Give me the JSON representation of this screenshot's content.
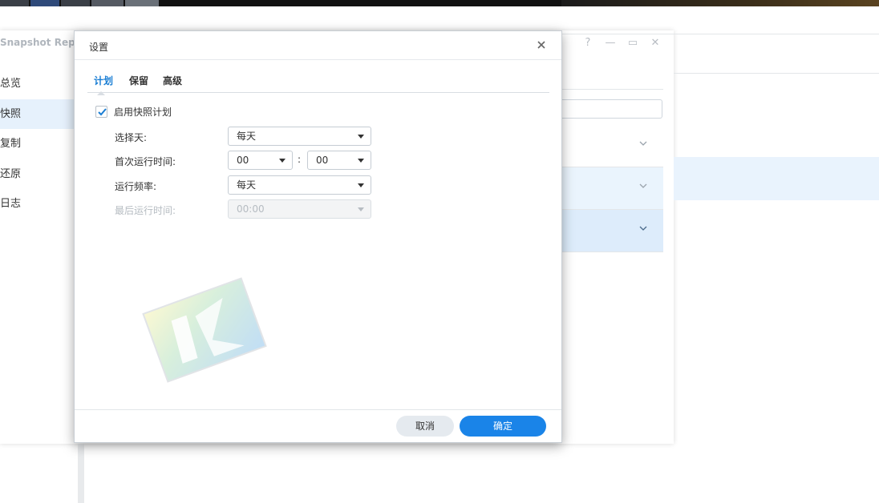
{
  "background_app": {
    "title": "Snapshot Repl",
    "window_controls": [
      "?",
      "—",
      "▭",
      "✕"
    ],
    "sidebar": {
      "items": [
        {
          "label": "总览",
          "active": false
        },
        {
          "label": "快照",
          "active": true
        },
        {
          "label": "复制",
          "active": false
        },
        {
          "label": "还原",
          "active": false
        },
        {
          "label": "日志",
          "active": false
        }
      ]
    }
  },
  "dialog": {
    "title": "设置",
    "tabs": [
      {
        "label": "计划",
        "active": true
      },
      {
        "label": "保留",
        "active": false
      },
      {
        "label": "高级",
        "active": false
      }
    ],
    "enable_schedule": {
      "label": "启用快照计划",
      "checked": true
    },
    "fields": {
      "select_day": {
        "label": "选择天:",
        "value": "每天"
      },
      "first_run_time": {
        "label": "首次运行时间:",
        "hour": "00",
        "separator": ":",
        "minute": "00"
      },
      "frequency": {
        "label": "运行频率:",
        "value": "每天"
      },
      "last_run_time": {
        "label": "最后运行时间:",
        "value": "00:00",
        "disabled": true
      }
    },
    "buttons": {
      "cancel": "取消",
      "ok": "确定"
    }
  },
  "colors": {
    "accent": "#1a84e8",
    "tab_active": "#1a7ed4",
    "sidebar_active_bg": "#e6f1fc"
  }
}
